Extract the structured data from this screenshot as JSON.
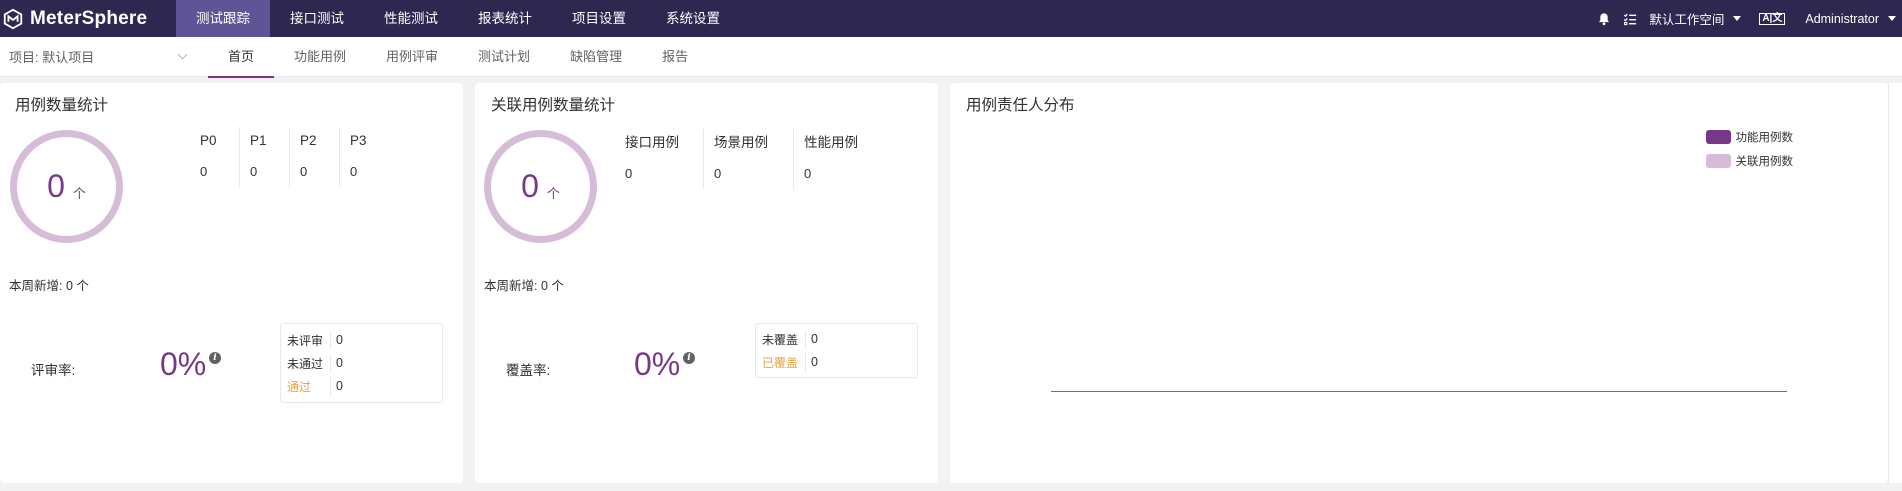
{
  "brand": {
    "name": "MeterSphere"
  },
  "topnav": [
    {
      "label": "测试跟踪"
    },
    {
      "label": "接口测试"
    },
    {
      "label": "性能测试"
    },
    {
      "label": "报表统计"
    },
    {
      "label": "项目设置"
    },
    {
      "label": "系统设置"
    }
  ],
  "topright": {
    "workspace": "默认工作空间",
    "user": "Administrator"
  },
  "project": {
    "label": "项目: 默认项目"
  },
  "subnav": [
    {
      "label": "首页"
    },
    {
      "label": "功能用例"
    },
    {
      "label": "用例评审"
    },
    {
      "label": "测试计划"
    },
    {
      "label": "缺陷管理"
    },
    {
      "label": "报告"
    }
  ],
  "case_count": {
    "title": "用例数量统计",
    "total": "0",
    "unit": "个",
    "columns": [
      {
        "header": "P0",
        "value": "0"
      },
      {
        "header": "P1",
        "value": "0"
      },
      {
        "header": "P2",
        "value": "0"
      },
      {
        "header": "P3",
        "value": "0"
      }
    ],
    "new_label": "本周新增:",
    "new_value": "0 个",
    "rate_label": "评审率:",
    "rate_value": "0%",
    "details": [
      {
        "label": "未评审",
        "value": "0",
        "highlight": false
      },
      {
        "label": "未通过",
        "value": "0",
        "highlight": false
      },
      {
        "label": "通过",
        "value": "0",
        "highlight": true
      }
    ]
  },
  "related_count": {
    "title": "关联用例数量统计",
    "total": "0",
    "unit": "个",
    "columns": [
      {
        "header": "接口用例",
        "value": "0"
      },
      {
        "header": "场景用例",
        "value": "0"
      },
      {
        "header": "性能用例",
        "value": "0"
      }
    ],
    "new_label": "本周新增:",
    "new_value": "0 个",
    "rate_label": "覆盖率:",
    "rate_value": "0%",
    "details": [
      {
        "label": "未覆盖",
        "value": "0",
        "highlight": false
      },
      {
        "label": "已覆盖",
        "value": "0",
        "highlight": true
      }
    ]
  },
  "owner_dist": {
    "title": "用例责任人分布",
    "legend": [
      {
        "label": "功能用例数",
        "color": "#783887"
      },
      {
        "label": "关联用例数",
        "color": "#d5bdd7"
      }
    ]
  },
  "chart_data": {
    "type": "bar",
    "title": "用例责任人分布",
    "categories": [],
    "series": [
      {
        "name": "功能用例数",
        "values": []
      },
      {
        "name": "关联用例数",
        "values": []
      }
    ],
    "legend_position": "top-right",
    "grid": false
  },
  "colors": {
    "topbar": "#2e2750",
    "active_tab": "#5f5495",
    "accent": "#783887",
    "ring": "#d5bdd7",
    "warning": "#e6a23c"
  }
}
